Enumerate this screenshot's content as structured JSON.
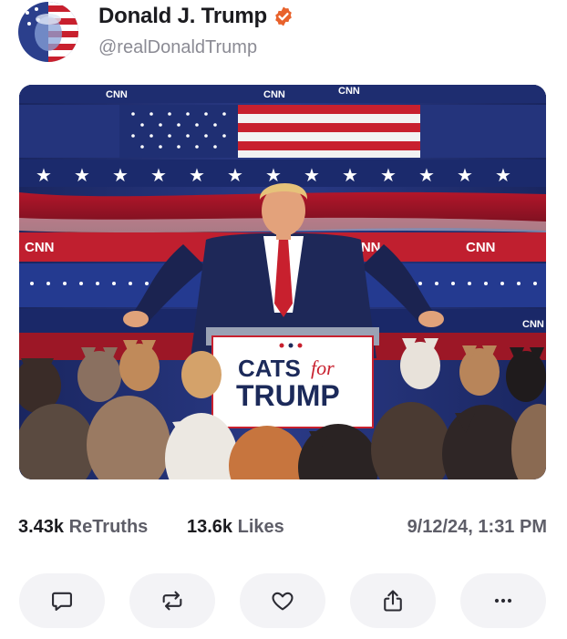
{
  "post": {
    "author": {
      "display_name": "Donald J. Trump",
      "handle": "@realDonaldTrump",
      "verified": true
    },
    "image": {
      "sign_line1": "CATS",
      "sign_line2": "for",
      "sign_line3": "TRUMP",
      "banner_text": "CNN"
    },
    "stats": {
      "retruths_count": "3.43k",
      "retruths_label": "ReTruths",
      "likes_count": "13.6k",
      "likes_label": "Likes",
      "timestamp": "9/12/24, 1:31 PM"
    }
  },
  "actions": [
    {
      "icon": "reply-icon"
    },
    {
      "icon": "retruth-icon"
    },
    {
      "icon": "like-icon"
    },
    {
      "icon": "share-icon"
    },
    {
      "icon": "more-icon"
    }
  ],
  "colors": {
    "accent_orange": "#e8622c",
    "navy": "#1c2a5a",
    "red": "#c8202e",
    "button_bg": "#f3f3f6"
  }
}
